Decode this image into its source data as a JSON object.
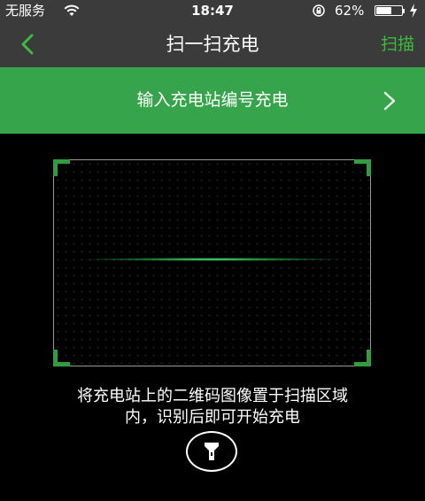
{
  "status_bar": {
    "carrier": "无服务",
    "time": "18:47",
    "battery_percent": "62%",
    "battery_level": 0.62
  },
  "nav": {
    "title": "扫一扫充电",
    "right_action": "扫描"
  },
  "input_row": {
    "label": "输入充电站编号充电"
  },
  "scanner": {
    "hint_line1": "将充电站上的二维码图像置于扫描区域",
    "hint_line2": "内，识别后即可开始充电"
  },
  "colors": {
    "accent_green": "#3bbd3b",
    "banner_green": "#36a44a",
    "bar_background": "#3b3b3b",
    "background": "#000000"
  },
  "icons": {
    "back": "chevron-left-icon",
    "input_row": "chevron-right-icon",
    "flashlight": "flashlight-icon"
  }
}
